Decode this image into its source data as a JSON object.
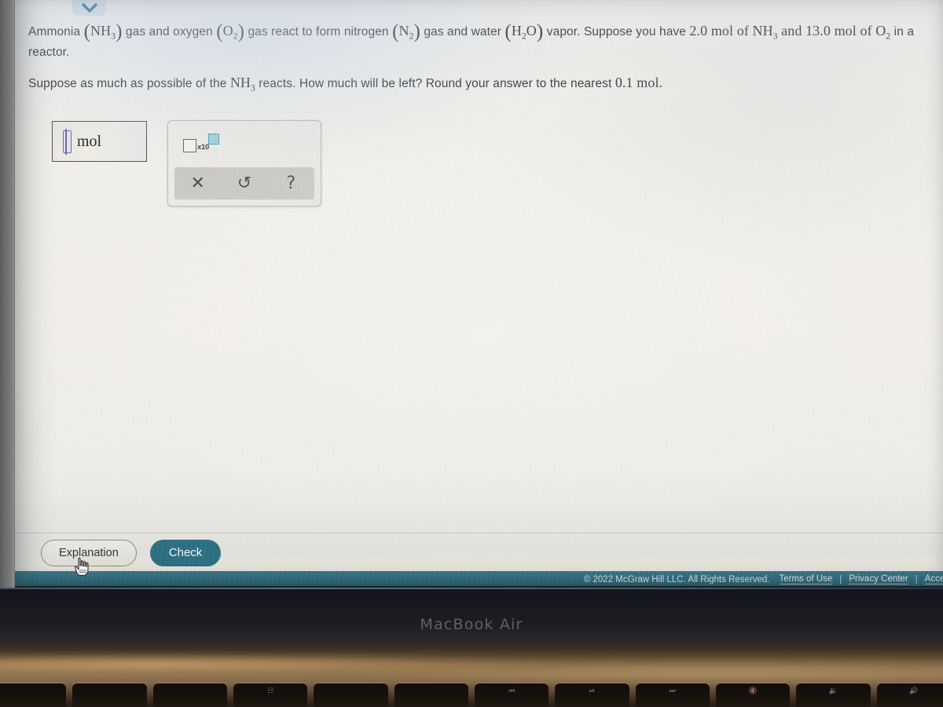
{
  "device": {
    "bezel_label": "MacBook Air"
  },
  "toolbar": {
    "collapse_icon": "chevron-down-icon"
  },
  "problem": {
    "paragraph1": {
      "seg1": "Ammonia ",
      "f1_open": "(",
      "f1_main": "NH",
      "f1_sub": "3",
      "f1_close": ")",
      "seg2": " gas and oxygen ",
      "f2_open": "(",
      "f2_main": "O",
      "f2_sub": "2",
      "f2_close": ")",
      "seg3": " gas react to form nitrogen ",
      "f3_open": "(",
      "f3_main": "N",
      "f3_sub": "2",
      "f3_close": ")",
      "seg4": " gas and water ",
      "f4_open": "(",
      "f4_main_a": "H",
      "f4_sub": "2",
      "f4_main_b": "O",
      "f4_close": ")",
      "seg5": " vapor. Suppose you have ",
      "amount1": "2.0",
      "seg6": " mol of ",
      "f5_main": "NH",
      "f5_sub": "3",
      "seg7": " and ",
      "amount2": "13.0",
      "seg8": " mol of ",
      "f6_main": "O",
      "f6_sub": "2",
      "seg9": " in a reactor."
    },
    "paragraph2": {
      "seg1": "Suppose as much as possible of the ",
      "f1_main": "NH",
      "f1_sub": "3",
      "seg2": " reacts. How much will be left? Round your answer to the nearest ",
      "amount": "0.1",
      "seg3": " mol."
    }
  },
  "answer": {
    "value": "",
    "placeholder": "",
    "unit": "mol"
  },
  "tool_panel": {
    "sci_notation": {
      "mantissa": "",
      "times_ten": "x10",
      "exponent": ""
    },
    "buttons": [
      {
        "name": "clear-button",
        "glyph": "✕",
        "label": "Clear"
      },
      {
        "name": "undo-button",
        "glyph": "↺",
        "label": "Undo"
      },
      {
        "name": "help-button",
        "glyph": "?",
        "label": "Help"
      }
    ]
  },
  "actions": {
    "explanation_label": "Explanation",
    "check_label": "Check"
  },
  "footer": {
    "copyright": "© 2022 McGraw Hill LLC. All Rights Reserved.",
    "links": [
      {
        "label": "Terms of Use"
      },
      {
        "label": "Privacy Center"
      },
      {
        "label": "Acces"
      }
    ],
    "separator": "|"
  },
  "colors": {
    "page_background": "#eceae3",
    "footer_teal": "#35707f",
    "check_button_teal": "#2e7183",
    "caret_purple": "#6b62b4",
    "exponent_teal": "#9fd0d6",
    "chevron_teal": "#2e7183"
  },
  "keyboard": {
    "keys": [
      "",
      "",
      "",
      "☷",
      "",
      "",
      "⏮",
      "⏯",
      "⏭",
      "🔇",
      "🔉",
      "🔊"
    ]
  }
}
